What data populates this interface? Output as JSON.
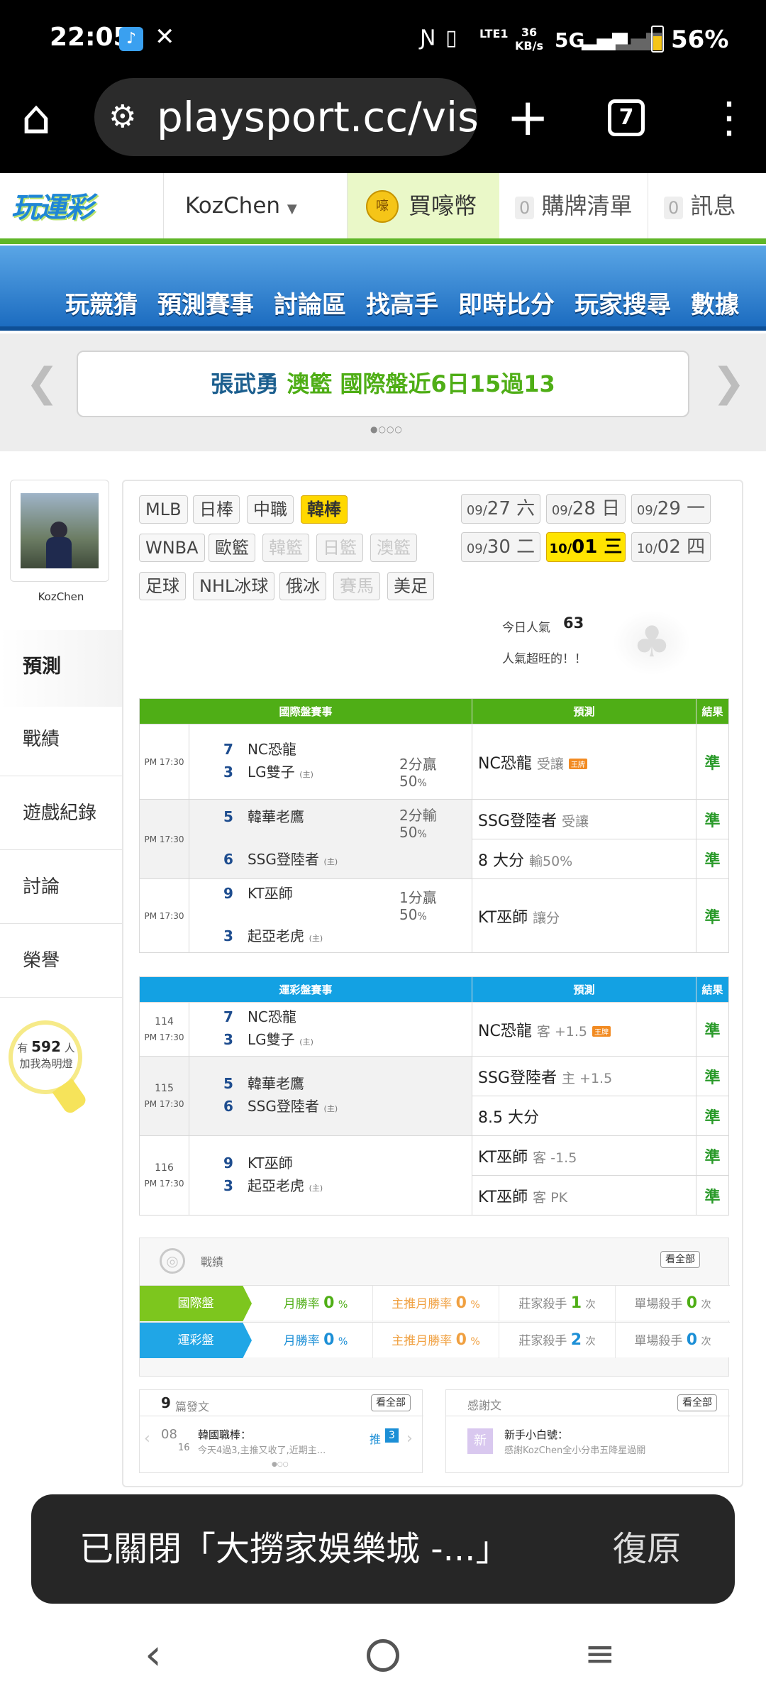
{
  "status_bar": {
    "time": "22:05",
    "network_speed": "36\nKB/s",
    "network_speed_top": "36",
    "network_speed_bottom": "KB/s",
    "lte": "LTE1",
    "network": "5G",
    "battery": "56%"
  },
  "browser": {
    "url": "playsport.cc/visit",
    "tab_count": "7"
  },
  "site_header": {
    "user": "KozChen",
    "buy": "買嚎幣",
    "cart_count": "0",
    "cart_label": "購牌清單",
    "msg_count": "0",
    "msg_label": "訊息"
  },
  "nav": [
    "玩競猜",
    "預測賽事",
    "討論區",
    "找高手",
    "即時比分",
    "玩家搜尋",
    "數據"
  ],
  "banner": {
    "part1": "張武勇",
    "part2": "澳籃",
    "part3": "國際盤近6日15過13"
  },
  "profile": {
    "name": "KozChen",
    "tabs": [
      "預測",
      "戰績",
      "遊戲紀錄",
      "討論",
      "榮譽"
    ],
    "fans_prefix": "有",
    "fans_count": "592",
    "fans_suffix": "人",
    "fans_line2": "加我為明燈"
  },
  "leagues": {
    "row1": [
      "MLB",
      "日棒",
      "中職",
      "韓棒"
    ],
    "row2": [
      "WNBA",
      "歐籃",
      "韓籃",
      "日籃",
      "澳籃"
    ],
    "row3": [
      "足球",
      "NHL冰球",
      "俄冰",
      "賽馬",
      "美足"
    ],
    "selected": "韓棒"
  },
  "dates": [
    {
      "m": "09/",
      "d": "27",
      "w": "六"
    },
    {
      "m": "09/",
      "d": "28",
      "w": "日"
    },
    {
      "m": "09/",
      "d": "29",
      "w": "一"
    },
    {
      "m": "09/",
      "d": "30",
      "w": "二"
    },
    {
      "m": "10/",
      "d": "01",
      "w": "三"
    },
    {
      "m": "10/",
      "d": "02",
      "w": "四"
    }
  ],
  "popularity": {
    "label": "今日人氣",
    "value": "63",
    "note": "人氣超旺的！！"
  },
  "intl_table": {
    "headers": [
      "國際盤賽事",
      "預測",
      "結果"
    ],
    "games": [
      {
        "time": "PM 17:30",
        "away_num": "7",
        "away": "NC恐龍",
        "home_num": "3",
        "home": "LG雙子",
        "home_tag": "(主)",
        "odds": "2分贏",
        "odds_pct": "50",
        "preds": [
          {
            "team": "NC恐龍",
            "sub": "受讓",
            "king": "王牌",
            "result": "準"
          }
        ]
      },
      {
        "time": "PM 17:30",
        "away_num": "5",
        "away": "韓華老鷹",
        "home_num": "6",
        "home": "SSG登陸者",
        "home_tag": "(主)",
        "odds": "2分輸",
        "odds_pct": "50",
        "preds": [
          {
            "team": "SSG登陸者",
            "sub": "受讓",
            "result": "準"
          },
          {
            "team": "8 大分",
            "sub": "輸50%",
            "result": "準"
          }
        ]
      },
      {
        "time": "PM 17:30",
        "away_num": "9",
        "away": "KT巫師",
        "home_num": "3",
        "home": "起亞老虎",
        "home_tag": "(主)",
        "odds": "1分贏",
        "odds_pct": "50",
        "preds": [
          {
            "team": "KT巫師",
            "sub": "讓分",
            "result": "準"
          }
        ]
      }
    ]
  },
  "lottery_table": {
    "headers": [
      "運彩盤賽事",
      "預測",
      "結果"
    ],
    "games": [
      {
        "no": "114",
        "time": "PM 17:30",
        "away_num": "7",
        "away": "NC恐龍",
        "home_num": "3",
        "home": "LG雙子",
        "home_tag": "(主)",
        "preds": [
          {
            "team": "NC恐龍",
            "sub": "客 +1.5",
            "king": "王牌",
            "result": "準"
          }
        ]
      },
      {
        "no": "115",
        "time": "PM 17:30",
        "away_num": "5",
        "away": "韓華老鷹",
        "home_num": "6",
        "home": "SSG登陸者",
        "home_tag": "(主)",
        "preds": [
          {
            "team": "SSG登陸者",
            "sub": "主 +1.5",
            "result": "準"
          },
          {
            "team": "8.5 大分",
            "sub": "",
            "result": "準"
          }
        ]
      },
      {
        "no": "116",
        "time": "PM 17:30",
        "away_num": "9",
        "away": "KT巫師",
        "home_num": "3",
        "home": "起亞老虎",
        "home_tag": "(主)",
        "preds": [
          {
            "team": "KT巫師",
            "sub": "客 -1.5",
            "result": "準"
          },
          {
            "team": "KT巫師",
            "sub": "客 PK",
            "result": "準"
          }
        ]
      }
    ]
  },
  "record": {
    "title": "戰績",
    "view_all": "看全部",
    "rows": [
      {
        "label": "國際盤",
        "win_rate_label": "月勝率",
        "win_rate": "0",
        "main_rate_label": "主推月勝率",
        "main_rate": "0",
        "pct": "%",
        "banker_label": "莊家殺手",
        "banker": "1",
        "single_label": "單場殺手",
        "single": "0",
        "unit": "次",
        "color": "#7dc61e"
      },
      {
        "label": "運彩盤",
        "win_rate_label": "月勝率",
        "win_rate": "0",
        "main_rate_label": "主推月勝率",
        "main_rate": "0",
        "pct": "%",
        "banker_label": "莊家殺手",
        "banker": "2",
        "single_label": "單場殺手",
        "single": "0",
        "unit": "次",
        "color": "#20a6e6"
      }
    ]
  },
  "posts": {
    "count": "9",
    "count_label": "篇發文",
    "view_all": "看全部",
    "month": "08",
    "day": "16",
    "title": "韓國職棒：",
    "excerpt": "今天4過3,主推又收了,近期主...",
    "push_label": "推",
    "push_count": "3"
  },
  "thanks": {
    "title": "感謝文",
    "view_all": "看全部",
    "badge": "新",
    "name": "新手小白號：",
    "text": "感謝KozChen全小分串五降星過關"
  },
  "toast": {
    "message": "已關閉「大撈家娛樂城 -...」",
    "action": "復原"
  },
  "colors": {
    "green": "#4fae16",
    "blue": "#13a1e3",
    "nav_blue": "#1c6cc0",
    "result_green": "#2a9a2a",
    "selected_yellow": "#ffd800"
  }
}
